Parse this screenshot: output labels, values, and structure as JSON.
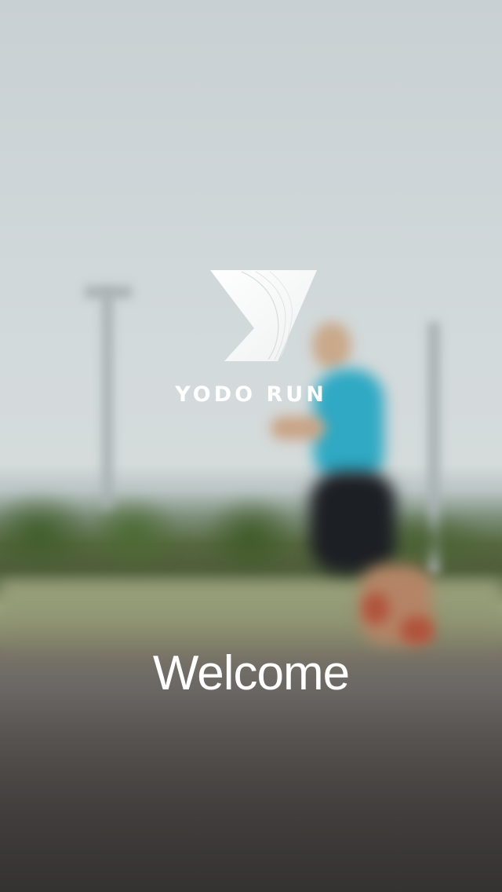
{
  "app": {
    "brand_name": "YODO RUN",
    "logo_icon": "yodo-run-logo-icon"
  },
  "splash": {
    "welcome_text": "Welcome"
  },
  "colors": {
    "text": "#ffffff",
    "shirt_accent": "#2fa9c4"
  }
}
